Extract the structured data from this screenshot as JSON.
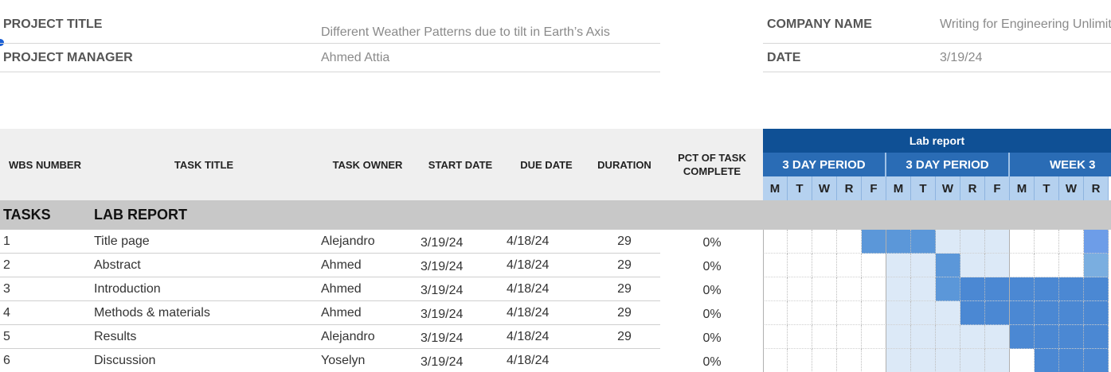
{
  "project": {
    "title_label": "PROJECT TITLE",
    "title_value": "Different Weather Patterns due to tilt in Earth’s Axis",
    "manager_label": "PROJECT MANAGER",
    "manager_value": "Ahmed Attia",
    "company_label": "COMPANY NAME",
    "company_value": "Writing for Engineering  Unlimited",
    "date_label": "DATE",
    "date_value": "3/19/24"
  },
  "columns": {
    "wbs": "WBS NUMBER",
    "task": "TASK TITLE",
    "owner": "TASK OWNER",
    "start": "START DATE",
    "due": "DUE DATE",
    "duration": "DURATION",
    "pct": "PCT OF TASK COMPLETE"
  },
  "gantt": {
    "title": "Lab report",
    "periods": [
      "3 DAY PERIOD",
      "3 DAY PERIOD",
      "WEEK 3"
    ],
    "days": [
      "M",
      "T",
      "W",
      "R",
      "F",
      "M",
      "T",
      "W",
      "R",
      "F",
      "M",
      "T",
      "W",
      "R"
    ]
  },
  "section": {
    "label": "TASKS",
    "title": "LAB REPORT"
  },
  "rows": [
    {
      "wbs": "1",
      "task": "Title page",
      "owner": "Alejandro",
      "start": "3/19/24",
      "due": "4/18/24",
      "duration": "29",
      "pct": "0%",
      "bar": [
        "e",
        "e",
        "e",
        "e",
        "m",
        "m",
        "m",
        "l",
        "l",
        "l",
        "e",
        "e",
        "e",
        "p"
      ]
    },
    {
      "wbs": "2",
      "task": "Abstract",
      "owner": "Ahmed",
      "start": "3/19/24",
      "due": "4/18/24",
      "duration": "29",
      "pct": "0%",
      "bar": [
        "e",
        "e",
        "e",
        "e",
        "e",
        "l",
        "l",
        "m",
        "l",
        "l",
        "e",
        "e",
        "e",
        "c"
      ]
    },
    {
      "wbs": "3",
      "task": "Introduction",
      "owner": "Ahmed",
      "start": "3/19/24",
      "due": "4/18/24",
      "duration": "29",
      "pct": "0%",
      "bar": [
        "e",
        "e",
        "e",
        "e",
        "e",
        "l",
        "l",
        "m",
        "d",
        "d",
        "d",
        "d",
        "d",
        "d"
      ]
    },
    {
      "wbs": "4",
      "task": "Methods & materials",
      "owner": "Ahmed",
      "start": "3/19/24",
      "due": "4/18/24",
      "duration": "29",
      "pct": "0%",
      "bar": [
        "e",
        "e",
        "e",
        "e",
        "e",
        "l",
        "l",
        "l",
        "d",
        "d",
        "d",
        "d",
        "d",
        "d"
      ]
    },
    {
      "wbs": "5",
      "task": "Results",
      "owner": "Alejandro",
      "start": "3/19/24",
      "due": "4/18/24",
      "duration": "29",
      "pct": "0%",
      "bar": [
        "e",
        "e",
        "e",
        "e",
        "e",
        "l",
        "l",
        "l",
        "l",
        "l",
        "d",
        "d",
        "d",
        "d"
      ]
    },
    {
      "wbs": "6",
      "task": "Discussion",
      "owner": "Yoselyn",
      "start": "3/19/24",
      "due": "4/18/24",
      "duration": "",
      "pct": "0%",
      "bar": [
        "e",
        "e",
        "e",
        "e",
        "e",
        "l",
        "l",
        "l",
        "l",
        "l",
        "e",
        "d",
        "d",
        "d"
      ]
    }
  ],
  "colors": {
    "gantt_title": "#0f5095",
    "period": "#2a6cb5",
    "day": "#b5d1ef",
    "bar_light": "#dce9f7",
    "bar_medium": "#5b97d9",
    "bar_dark": "#4b88d3",
    "section": "#c8c8c8",
    "header": "#efefef"
  }
}
